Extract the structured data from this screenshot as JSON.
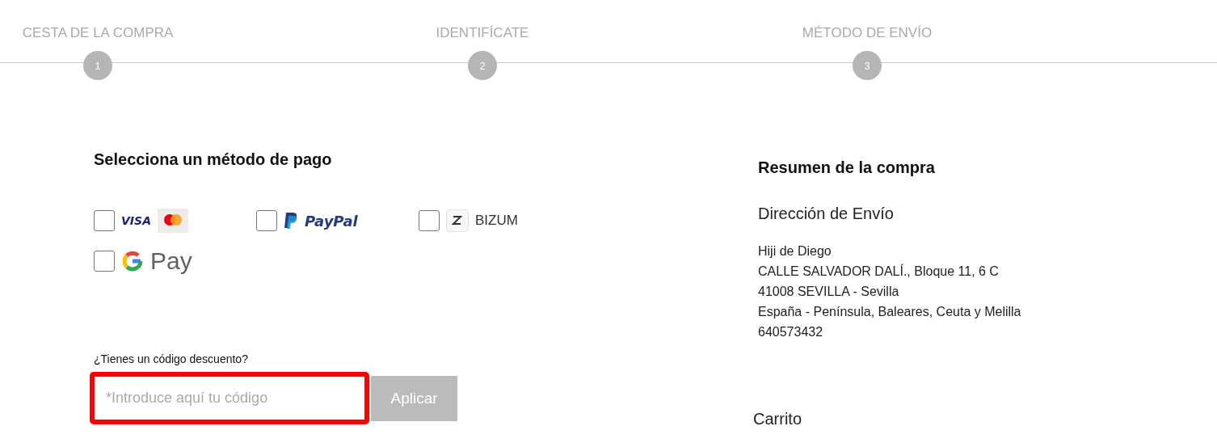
{
  "steps": [
    {
      "label": "CESTA DE LA COMPRA",
      "number": "1",
      "selected": false
    },
    {
      "label": "IDENTIFÍCATE",
      "number": "2",
      "selected": false
    },
    {
      "label": "MÉTODO DE ENVÍO",
      "number": "3",
      "selected": false
    }
  ],
  "payment": {
    "title": "Selecciona un método de pago",
    "methods": [
      {
        "kind": "card",
        "logo_text": "VISA",
        "checked": false
      },
      {
        "kind": "paypal",
        "logo_text": "PayPal",
        "checked": false
      },
      {
        "kind": "bizum",
        "label": "BIZUM",
        "checked": false
      },
      {
        "kind": "gpay",
        "logo_text": "Pay",
        "checked": false
      }
    ]
  },
  "discount": {
    "label": "¿Tienes un código descuento?",
    "placeholder": "*Introduce aquí tu código",
    "highlighted": true,
    "button": "Aplicar"
  },
  "summary": {
    "title": "Resumen de la compra",
    "address_title": "Dirección de Envío",
    "address_lines": [
      "Hiji de Diego",
      "CALLE SALVADOR DALÍ., Bloque 11, 6 C",
      "41008 SEVILLA - Sevilla",
      "España - Península, Baleares, Ceuta y Melilla",
      "640573432"
    ],
    "cart_title": "Carrito"
  }
}
